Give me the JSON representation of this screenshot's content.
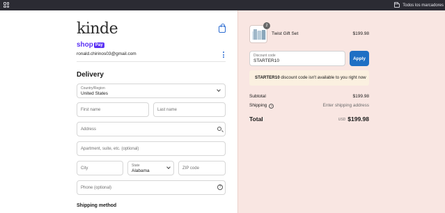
{
  "browser": {
    "bookmark_folder": "Todos los marcadores"
  },
  "brand": {
    "logo_text": "kinde"
  },
  "express": {
    "shop_label": "shop",
    "pay_label": "Pay"
  },
  "account": {
    "email": "ronald.chirinos03@gmail.com"
  },
  "delivery": {
    "heading": "Delivery",
    "country_label": "Country/Region",
    "country_value": "United States",
    "first_name_placeholder": "First name",
    "last_name_placeholder": "Last name",
    "address_placeholder": "Address",
    "apartment_placeholder": "Apartment, suite, etc. (optional)",
    "city_placeholder": "City",
    "state_label": "State",
    "state_value": "Alabama",
    "zip_placeholder": "ZIP code",
    "phone_placeholder": "Phone (optional)"
  },
  "shipping_method": {
    "heading": "Shipping method"
  },
  "summary": {
    "item": {
      "quantity": "2",
      "name": "Twist Gift Set",
      "price": "$199.98"
    },
    "discount": {
      "label": "Discount code",
      "value": "STARTER10",
      "apply_label": "Apply",
      "notice_code": "STARTER10",
      "notice_text": " discount code isn't available to you right now"
    },
    "subtotal_label": "Subtotal",
    "subtotal_value": "$199.98",
    "shipping_label": "Shipping",
    "shipping_value": "Enter shipping address",
    "total_label": "Total",
    "total_currency": "USD",
    "total_value": "$199.98"
  },
  "colors": {
    "summary_bg": "#f9e6e2",
    "apply_button": "#1f6fc4",
    "shop_pay": "#5a31f4",
    "notice_bg": "#fbf0e0"
  }
}
